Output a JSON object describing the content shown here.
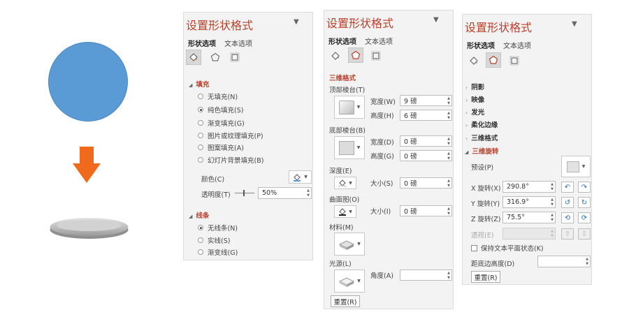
{
  "panel_title": "设置形状格式",
  "tabs": {
    "shape": "形状选项",
    "text": "文本选项"
  },
  "fill_panel": {
    "section_fill": "填充",
    "fill_options": [
      "无填充(N)",
      "纯色填充(S)",
      "渐变填充(G)",
      "图片或纹理填充(P)",
      "图案填充(A)",
      "幻灯片背景填充(B)"
    ],
    "color_label": "颜色(C)",
    "transparency_label": "透明度(T)",
    "transparency_value": "50%",
    "section_line": "线条",
    "line_options": [
      "无线条(N)",
      "实线(S)",
      "渐变线(G)"
    ]
  },
  "format3d_panel": {
    "section": "三维格式",
    "top_bevel": "顶部棱台(T)",
    "top_width_label": "宽度(W)",
    "top_width_value": "9 磅",
    "top_height_label": "高度(H)",
    "top_height_value": "6 磅",
    "bottom_bevel": "底部棱台(B)",
    "bottom_width_label": "宽度(D)",
    "bottom_width_value": "0 磅",
    "bottom_height_label": "高度(G)",
    "bottom_height_value": "0 磅",
    "depth": "深度(E)",
    "depth_size_label": "大小(S)",
    "depth_size_value": "0 磅",
    "contour": "曲面图(O)",
    "contour_size_label": "大小(I)",
    "contour_size_value": "0 磅",
    "material": "材料(M)",
    "lighting": "光源(L)",
    "angle_label": "角度(A)",
    "angle_value": "",
    "reset": "重置(R)"
  },
  "rotation_panel": {
    "collapsed": [
      "阴影",
      "映像",
      "发光",
      "柔化边缘",
      "三维格式"
    ],
    "section": "三维旋转",
    "preset_label": "预设(P)",
    "x_label": "X 旋转(X)",
    "x_value": "290.8°",
    "y_label": "Y 旋转(Y)",
    "y_value": "316.9°",
    "z_label": "Z 旋转(Z)",
    "z_value": "75.5°",
    "perspective_label": "透视(E)",
    "keep_text_flat": "保持文本平面状态(K)",
    "distance_label": "距底边高度(D)",
    "distance_value": "",
    "reset": "重置(R)"
  },
  "colors": {
    "accent": "#b8412c",
    "circle": "#5b9bd5",
    "arrow": "#f06a1e"
  }
}
